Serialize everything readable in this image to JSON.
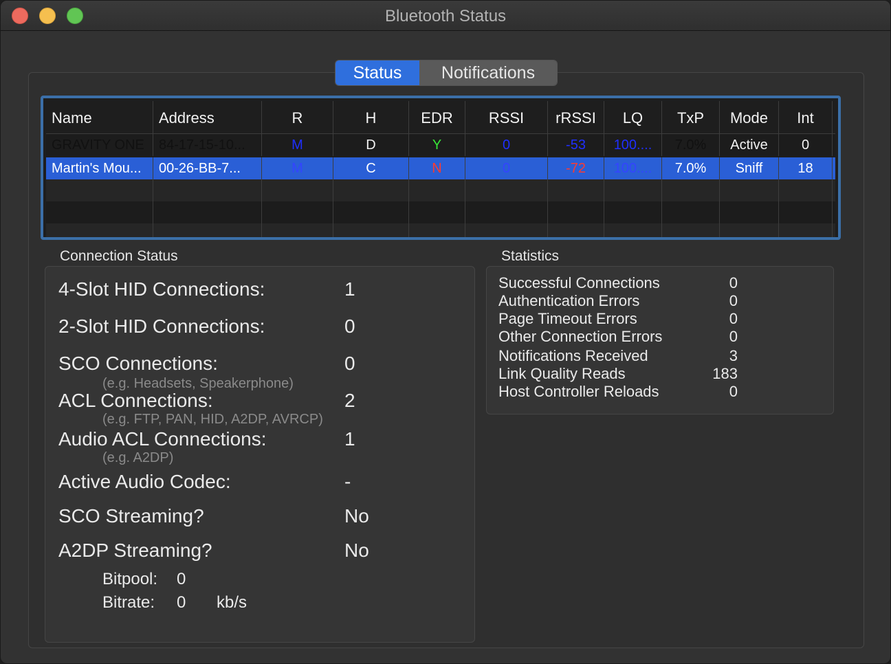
{
  "window": {
    "title": "Bluetooth Status"
  },
  "tabs": [
    {
      "label": "Status",
      "active": true
    },
    {
      "label": "Notifications",
      "active": false
    }
  ],
  "table": {
    "columns": [
      "Name",
      "Address",
      "R",
      "H",
      "EDR",
      "RSSI",
      "rRSSI",
      "LQ",
      "TxP",
      "Mode",
      "Int"
    ],
    "rows": [
      {
        "name": "GRAVITY ONE",
        "address": "84-17-15-10...",
        "r": "M",
        "h": "D",
        "edr": "Y",
        "rssi": "0",
        "rrssi": "-53",
        "lq": "100....",
        "txp": "7.0%",
        "mode": "Active",
        "int": "0"
      },
      {
        "name": "Martin's Mou...",
        "address": "00-26-BB-7...",
        "r": "M",
        "h": "C",
        "edr": "N",
        "rssi": "0",
        "rrssi": "-72",
        "lq": "100....",
        "txp": "7.0%",
        "mode": "Sniff",
        "int": "18"
      }
    ]
  },
  "connection_status": {
    "title": "Connection Status",
    "items": [
      {
        "label": "4-Slot HID Connections:",
        "value": "1"
      },
      {
        "label": "2-Slot HID Connections:",
        "value": "0"
      },
      {
        "label": "SCO Connections:",
        "value": "0",
        "hint": "(e.g. Headsets, Speakerphone)"
      },
      {
        "label": "ACL Connections:",
        "value": "2",
        "hint": "(e.g. FTP, PAN, HID, A2DP, AVRCP)"
      },
      {
        "label": "Audio ACL Connections:",
        "value": "1",
        "hint": "(e.g. A2DP)"
      },
      {
        "label": "Active Audio Codec:",
        "value": "-"
      },
      {
        "label": "SCO Streaming?",
        "value": "No"
      },
      {
        "label": "A2DP Streaming?",
        "value": "No"
      }
    ],
    "bitpool": {
      "label": "Bitpool:",
      "value": "0"
    },
    "bitrate": {
      "label": "Bitrate:",
      "value": "0",
      "unit": "kb/s"
    }
  },
  "statistics": {
    "title": "Statistics",
    "items": [
      {
        "label": "Successful Connections",
        "value": "0"
      },
      {
        "label": "Authentication Errors",
        "value": "0"
      },
      {
        "label": "Page Timeout Errors",
        "value": "0"
      },
      {
        "label": "Other Connection Errors",
        "value": "0"
      },
      {
        "label": "Notifications Received",
        "value": "3"
      },
      {
        "label": "Link Quality Reads",
        "value": "183"
      },
      {
        "label": "Host Controller Reloads",
        "value": "0"
      }
    ]
  }
}
